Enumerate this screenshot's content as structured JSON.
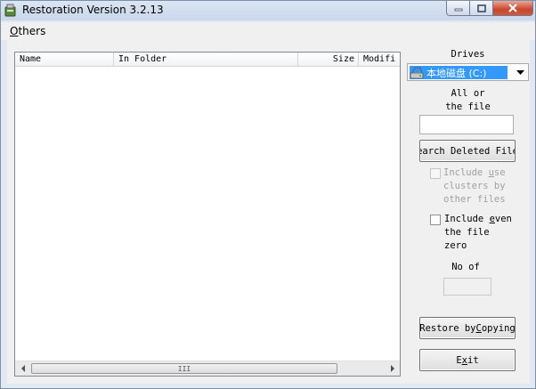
{
  "window": {
    "title": "Restoration Version 3.2.13"
  },
  "menu": {
    "others": {
      "hotkey": "O",
      "rest": "thers"
    }
  },
  "file_list": {
    "columns": [
      "Name",
      "In Folder",
      "Size",
      "Modifi"
    ],
    "rows": [],
    "scroll_grip": "III"
  },
  "drives": {
    "label": "Drives",
    "selected": "本地磁盘 (C:)"
  },
  "filter": {
    "label_line1": "All or",
    "label_line2": "the file",
    "value": ""
  },
  "search_button": {
    "label": "earch Deleted File"
  },
  "options": {
    "include_used": {
      "checked": false,
      "enabled": false,
      "line1_pre": "Include ",
      "line1_hot": "u",
      "line1_post": "se",
      "line2": "clusters by",
      "line3": "other files"
    },
    "include_zero": {
      "checked": false,
      "enabled": true,
      "line1_pre": "Include ",
      "line1_hot": "e",
      "line1_post": "ven",
      "line2": "the file",
      "line3": "zero"
    }
  },
  "count": {
    "label": "No of",
    "value": ""
  },
  "restore_button": {
    "label_pre": "Restore by ",
    "label_hot": "C",
    "label_post": "opying"
  },
  "exit_button": {
    "label_pre": "E",
    "label_hot": "x",
    "label_post": "it"
  },
  "colors": {
    "selection": "#3399ff",
    "close_button": "#c8462c",
    "window_frame": "#dfe8f3"
  }
}
